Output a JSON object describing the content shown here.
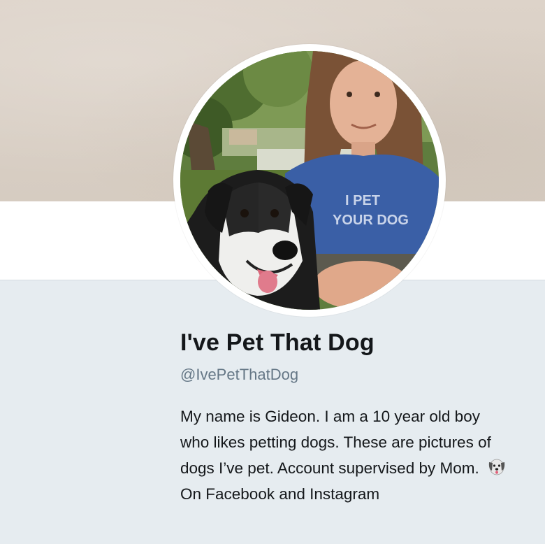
{
  "profile": {
    "display_name": "I've Pet That Dog",
    "handle": "@IvePetThatDog",
    "bio_part1": "My name is Gideon. I am a 10 year old boy who likes petting dogs. These are pictures of dogs I’ve pet. Account supervised by Mom.",
    "bio_emoji": "dog-face-icon",
    "bio_part2": "On Facebook and Instagram",
    "avatar_shirt_text": "I PET YOUR DOG"
  },
  "colors": {
    "banner": "#d9cfc5",
    "background": "#e6ecf0",
    "name_text": "#14171a",
    "handle_text": "#657786"
  }
}
